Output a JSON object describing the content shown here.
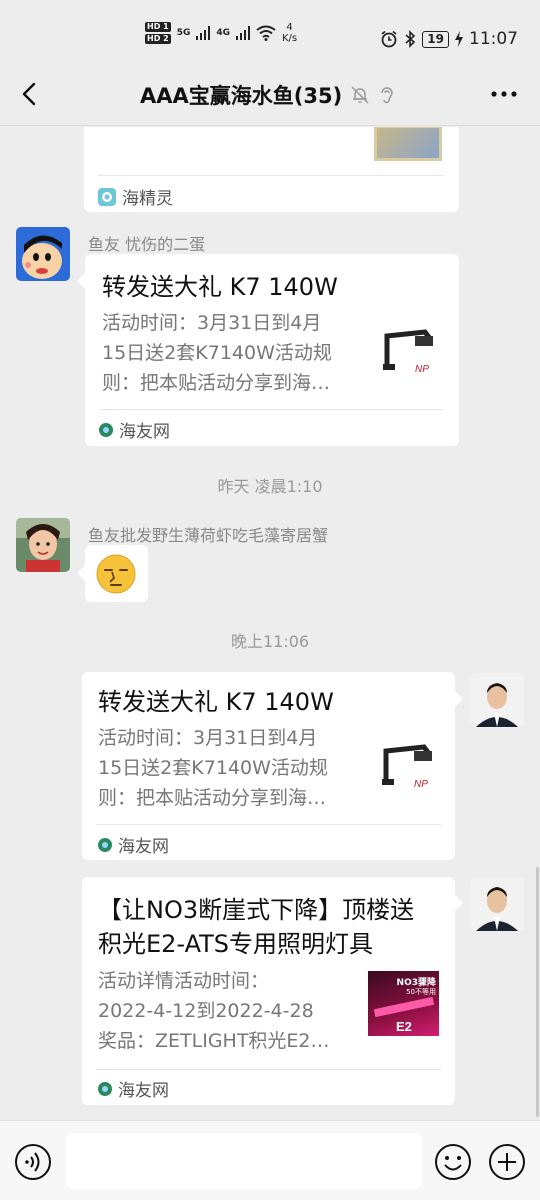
{
  "status_bar": {
    "hd1": "HD 1",
    "hd2": "HD 2",
    "net1": "5G",
    "net2": "4G",
    "speed_value": "4",
    "speed_unit": "K/s",
    "battery": "19",
    "time": "11:07"
  },
  "header": {
    "title": "AAA宝赢海水鱼(35)"
  },
  "messages": {
    "card0": {
      "source": "海精灵"
    },
    "msg1": {
      "sender": "鱼友 忧伤的二蛋",
      "title": "转发送大礼 K7 140W",
      "desc_lines": [
        "活动时间：3月31日到4月",
        "15日送2套K7140W活动规",
        "则：把本贴活动分享到海…"
      ],
      "source": "海友网"
    },
    "time1": "昨天 凌晨1:10",
    "msg2": {
      "sender": "鱼友批发野生薄荷虾吃毛藻寄居蟹"
    },
    "time2": "晚上11:06",
    "msg3": {
      "title": "转发送大礼 K7 140W",
      "desc_lines": [
        "活动时间：3月31日到4月",
        "15日送2套K7140W活动规",
        "则：把本贴活动分享到海…"
      ],
      "source": "海友网"
    },
    "msg4": {
      "title_lines": [
        "【让NO3断崖式下降】顶楼送",
        "积光E2-ATS专用照明灯具"
      ],
      "desc_lines": [
        "活动详情活动时间：",
        "2022-4-12到2022-4-28",
        "奖品：ZETLIGHT积光E2…"
      ],
      "source": "海友网",
      "thumb_text_top": "NO3骤降",
      "thumb_text_mid": "50不等用",
      "thumb_text_e2": "E2"
    }
  },
  "colors": {
    "background": "#ededed",
    "card": "#ffffff",
    "source_icon": "#2a8a5e"
  }
}
